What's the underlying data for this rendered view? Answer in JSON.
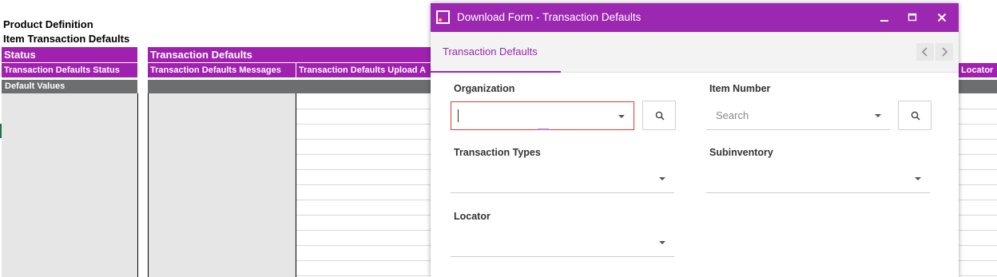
{
  "sheet": {
    "title1": "Product Definition",
    "title2": "Item Transaction Defaults",
    "group_headers": [
      "Status",
      "Transaction Defaults"
    ],
    "column_headers": [
      "Transaction Defaults Status",
      "Transaction Defaults Messages",
      "Transaction Defaults Upload A",
      "Locator"
    ],
    "default_values_label": "Default Values"
  },
  "dialog": {
    "title": "Download Form - Transaction Defaults",
    "app_icon": "form-window-icon",
    "window_controls": [
      "minimize-icon",
      "maximize-icon",
      "close-icon"
    ],
    "tab": "Transaction Defaults",
    "tab_nav": [
      "chevron-left-icon",
      "chevron-right-icon"
    ],
    "fields": {
      "organization": {
        "label": "Organization",
        "value": "",
        "search_icon": "search-icon"
      },
      "item_number": {
        "label": "Item Number",
        "placeholder": "Search",
        "search_icon": "search-icon"
      },
      "transaction_types": {
        "label": "Transaction Types",
        "value": ""
      },
      "subinventory": {
        "label": "Subinventory",
        "value": ""
      },
      "locator": {
        "label": "Locator",
        "value": ""
      }
    }
  },
  "colors": {
    "accent": "#9c27b0",
    "header_purple": "#a020b0",
    "gray_bar": "#6d6e70",
    "error_border": "#e53935"
  }
}
